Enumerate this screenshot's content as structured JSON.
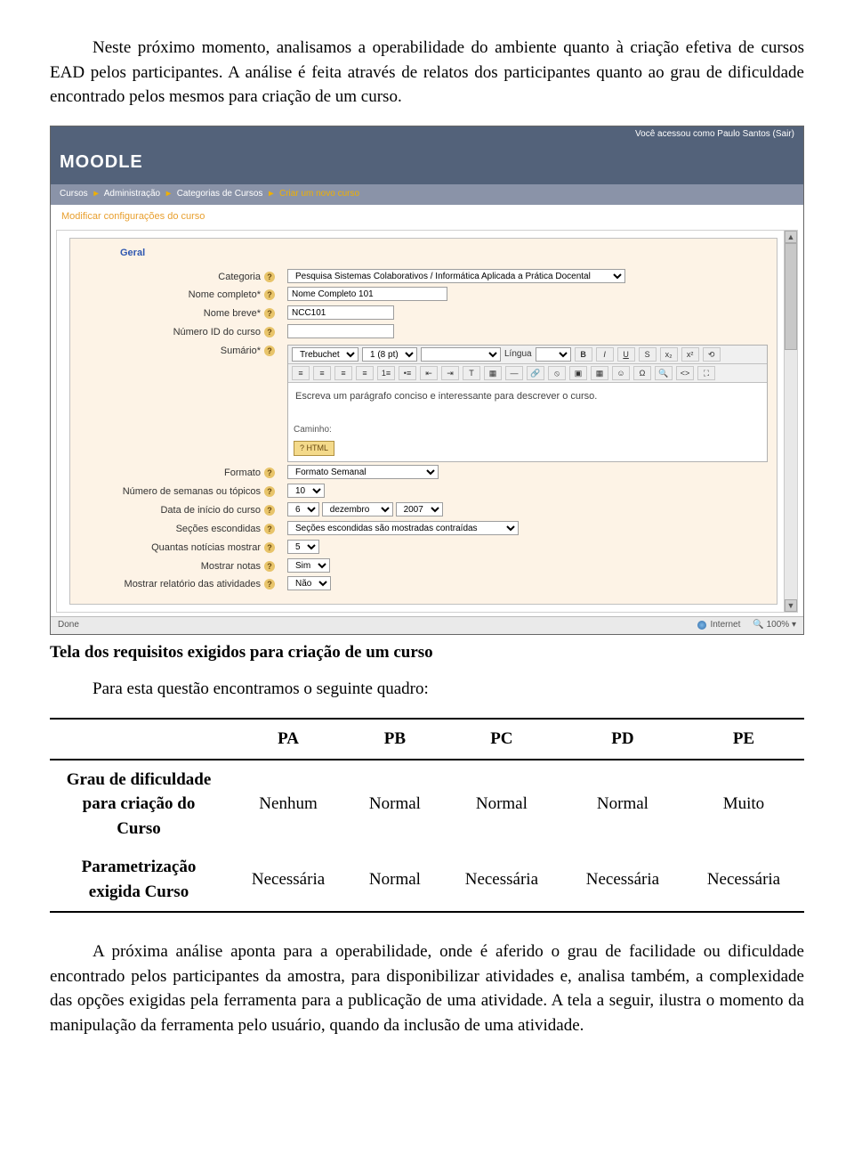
{
  "paragraphs": {
    "p1": "Neste próximo momento, analisamos a operabilidade do ambiente quanto à criação efetiva de cursos EAD pelos participantes. A análise é feita através de relatos dos participantes quanto ao grau de dificuldade encontrado pelos mesmos para criação de um curso.",
    "caption": "Tela dos requisitos exigidos para criação de um curso",
    "lead": "Para esta questão encontramos o seguinte quadro:",
    "p2": "A próxima análise aponta para a operabilidade, onde é aferido o grau de facilidade ou dificuldade encontrado pelos participantes da amostra, para disponibilizar atividades e, analisa também, a complexidade das opções exigidas pela ferramenta para a publicação de uma atividade. A tela a seguir, ilustra o momento da manipulação da ferramenta pelo usuário, quando da inclusão de uma atividade."
  },
  "screenshot": {
    "user_status": "Você acessou como Paulo Santos (Sair)",
    "brand": "MOODLE",
    "breadcrumb": {
      "items": [
        "Cursos",
        "Administração",
        "Categorias de Cursos"
      ],
      "current": "Criar um novo curso"
    },
    "page_title": "Modificar configurações do curso",
    "section_legend": "Geral",
    "labels": {
      "categoria": "Categoria",
      "nome_completo": "Nome completo*",
      "nome_breve": "Nome breve*",
      "numero_id": "Número ID do curso",
      "sumario": "Sumário*",
      "formato": "Formato",
      "semanas": "Número de semanas ou tópicos",
      "data_inicio": "Data de início do curso",
      "secoes": "Seções escondidas",
      "noticias": "Quantas notícias mostrar",
      "mostrar_notas": "Mostrar notas",
      "relatorio": "Mostrar relatório das atividades"
    },
    "values": {
      "categoria": "Pesquisa Sistemas Colaborativos / Informática Aplicada a Prática Docental",
      "nome_completo": "Nome Completo 101",
      "nome_breve": "NCC101",
      "numero_id": "",
      "font_family": "Trebuchet",
      "font_size": "1 (8 pt)",
      "lang_label": "Língua",
      "editor_placeholder": "Escreva um parágrafo conciso e interessante para descrever o curso.",
      "path_label": "Caminho:",
      "mode_btn": "? HTML",
      "formato": "Formato Semanal",
      "semanas": "10",
      "dia": "6",
      "mes": "dezembro",
      "ano": "2007",
      "secoes": "Seções escondidas são mostradas contraídas",
      "noticias": "5",
      "mostrar_notas": "Sim",
      "relatorio": "Não"
    },
    "statusbar": {
      "left": "Done",
      "zone": "Internet",
      "zoom": "100%"
    }
  },
  "table": {
    "headers": [
      "",
      "PA",
      "PB",
      "PC",
      "PD",
      "PE"
    ],
    "rows": [
      {
        "label": "Grau de dificuldade para criação do Curso",
        "cells": [
          "Nenhum",
          "Normal",
          "Normal",
          "Normal",
          "Muito"
        ]
      },
      {
        "label": "Parametrização exigida Curso",
        "cells": [
          "Necessária",
          "Normal",
          "Necessária",
          "Necessária",
          "Necessária"
        ]
      }
    ]
  }
}
